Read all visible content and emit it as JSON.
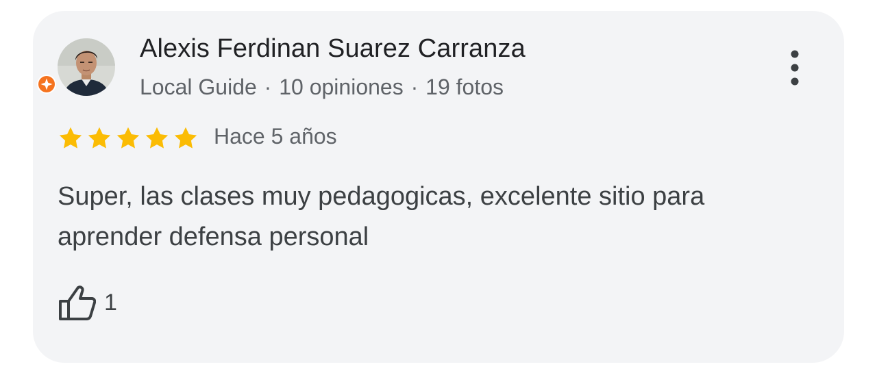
{
  "review": {
    "author_name": "Alexis Ferdinan Suarez Carranza",
    "author_badge": "Local Guide",
    "separator": "·",
    "reviews_count": "10 opiniones",
    "photos_count": "19 fotos",
    "rating": 5,
    "rating_max": 5,
    "time_ago": "Hace 5 años",
    "text": "Super, las clases muy pedagogicas, excelente sitio para aprender defensa personal",
    "likes": "1"
  },
  "colors": {
    "card_bg": "#f3f4f6",
    "star": "#fbbc04",
    "badge": "#f5731f",
    "text_primary": "#202124",
    "text_secondary": "#5f6368"
  },
  "icons": {
    "menu": "more-vert-icon",
    "like": "thumb-up-icon",
    "badge": "local-guide-badge-icon",
    "star": "star-icon"
  }
}
